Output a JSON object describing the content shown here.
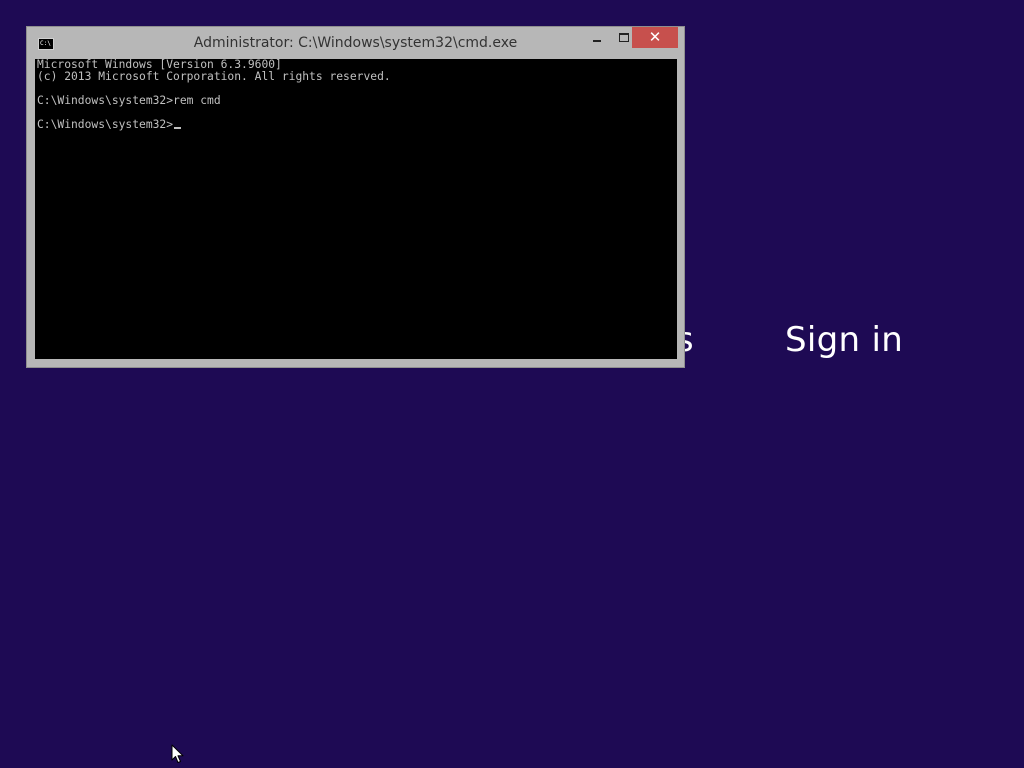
{
  "desktop": {
    "partial_heading": "gs",
    "signin_heading": "Sign in"
  },
  "console_window": {
    "title": "Administrator: C:\\Windows\\system32\\cmd.exe",
    "icon": "cmd-icon",
    "icon_text": "C:\\",
    "close_symbol": "✕",
    "lines": [
      "Microsoft Windows [Version 6.3.9600]",
      "(c) 2013 Microsoft Corporation. All rights reserved.",
      "",
      "C:\\Windows\\system32>rem cmd",
      "",
      "C:\\Windows\\system32>"
    ]
  },
  "colors": {
    "background": "#1e0a54",
    "window_frame": "#b7b7b7",
    "close_button": "#c7504d",
    "console_background": "#000000",
    "console_text": "#c0c0c0"
  }
}
